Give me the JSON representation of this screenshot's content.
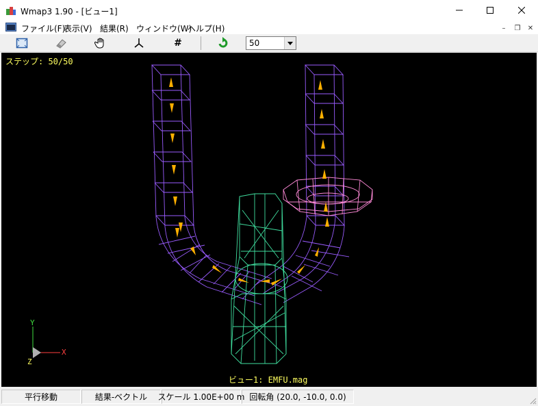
{
  "window": {
    "title": "Wmap3 1.90 - [ビュー1]",
    "minimize_glyph": "—",
    "maximize_glyph": "☐",
    "close_glyph": "✕"
  },
  "menu": {
    "items": [
      "ファイル(F)",
      "表示(V)",
      "結果(R)",
      "ウィンドウ(W)",
      "ヘルプ(H)"
    ],
    "mdi_minimize": "–",
    "mdi_restore": "❐",
    "mdi_close": "✕"
  },
  "toolbar": {
    "buttons": [
      "view-fit-icon",
      "eraser-icon",
      "hand-pan-icon",
      "axes-rotate-icon",
      "grid-hash-icon",
      "refresh-arrow-icon"
    ],
    "hash_glyph": "#",
    "step_combo_value": "50"
  },
  "viewport": {
    "step_text": "ステップ: 50/50",
    "view_caption": "ビュー1: EMFU.mag",
    "axis_x": "X",
    "axis_y": "Y",
    "axis_z": "Z",
    "colors": {
      "background": "#000000",
      "tube": "#9a5cff",
      "ring": "#ff8ad8",
      "cylinder": "#40e0a0",
      "arrows": "#ffb000",
      "text": "#ffff60"
    }
  },
  "status": {
    "mode": "平行移動",
    "result": "結果-ベクトル",
    "scale": "スケール 1.00E+00 m",
    "rotation": "回転角 (20.0, -10.0, 0.0)"
  }
}
